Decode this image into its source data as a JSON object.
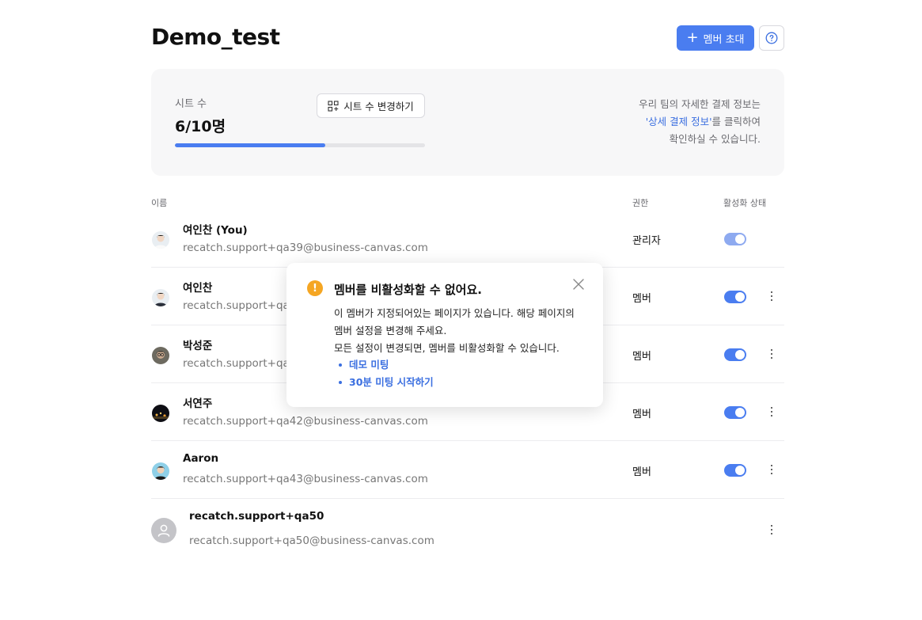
{
  "header": {
    "title": "Demo_test",
    "invite_label": "멤버 초대",
    "invite_icon": "plus-icon",
    "help_icon": "help-circle-icon"
  },
  "seats": {
    "label": "시트 수",
    "count": "6/10명",
    "used_fraction": 0.6,
    "change_label": "시트 수 변경하기",
    "change_icon": "seat-grid-icon",
    "billing_line1": "우리 팀의 자세한 결제 정보는",
    "billing_link": "'상세 결제 정보'",
    "billing_line2_rest": "를 클릭하여",
    "billing_line3": "확인하실 수 있습니다."
  },
  "columns": {
    "name": "이름",
    "role": "권한",
    "status": "활성화 상태"
  },
  "members": [
    {
      "name": "여인찬 (You)",
      "email": "recatch.support+qa39@business-canvas.com",
      "role": "관리자",
      "active": true,
      "toggle_disabled": true,
      "has_menu": false
    },
    {
      "name": "여인찬",
      "email": "recatch.support+qa4",
      "role": "멤버",
      "active": true,
      "toggle_disabled": false,
      "has_menu": true
    },
    {
      "name": "박성준",
      "email": "recatch.support+qa4",
      "role": "멤버",
      "active": true,
      "toggle_disabled": false,
      "has_menu": true
    },
    {
      "name": "서연주",
      "email": "recatch.support+qa42@business-canvas.com",
      "role": "멤버",
      "active": true,
      "toggle_disabled": false,
      "has_menu": true
    },
    {
      "name": "Aaron",
      "email": "recatch.support+qa43@business-canvas.com",
      "role": "멤버",
      "active": true,
      "toggle_disabled": false,
      "has_menu": true
    },
    {
      "name": "recatch.support+qa50",
      "email": "recatch.support+qa50@business-canvas.com",
      "role": "",
      "active": null,
      "toggle_disabled": false,
      "has_menu": true
    }
  ],
  "popup": {
    "icon": "warning-icon",
    "title": "멤버를 비활성화할 수 없어요.",
    "body_line1": "이 멤버가 지정되어있는 페이지가 있습니다. 해당 페이지의",
    "body_line2": "멤버 설정을 변경해 주세요.",
    "body_line3": "모든 설정이 변경되면, 멤버를 비활성화할 수 있습니다.",
    "links": [
      "데모 미팅",
      "30분 미팅 시작하기"
    ]
  },
  "colors": {
    "accent": "#4a7df0",
    "warning": "#f5a623",
    "card_bg": "#f7f7f8"
  }
}
